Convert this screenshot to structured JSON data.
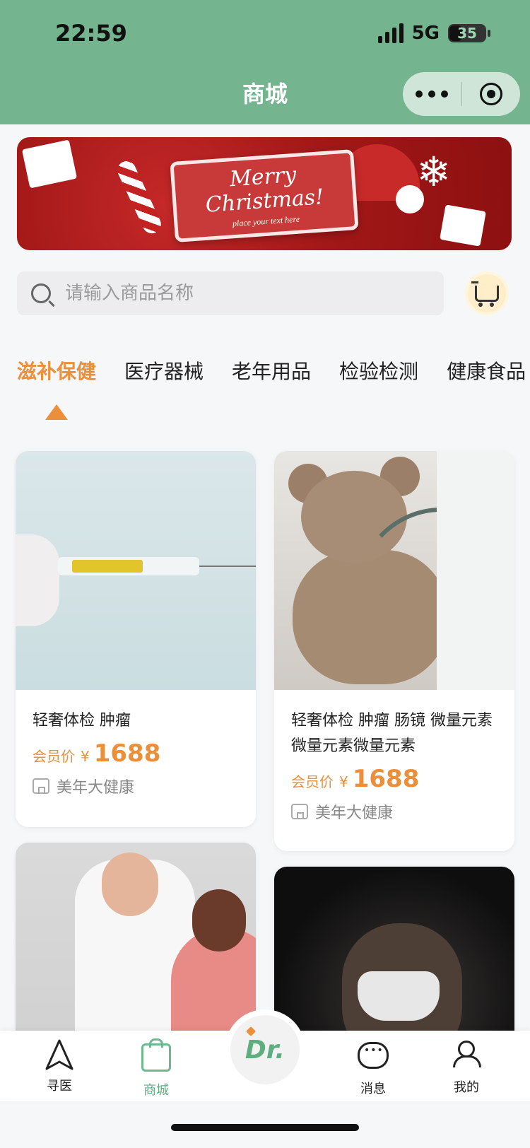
{
  "status_bar": {
    "time": "22:59",
    "network": "5G",
    "battery": "35"
  },
  "header": {
    "title": "商城"
  },
  "banner": {
    "title_line1": "Merry",
    "title_line2": "Christmas!",
    "subtitle": "place your text here"
  },
  "search": {
    "placeholder": "请输入商品名称"
  },
  "tabs": [
    {
      "label": "滋补保健"
    },
    {
      "label": "医疗器械"
    },
    {
      "label": "老年用品"
    },
    {
      "label": "检验检测"
    },
    {
      "label": "健康食品"
    }
  ],
  "products": [
    {
      "title": "轻奢体检 肿瘤",
      "price_label": "会员价",
      "currency": "¥",
      "price": "1688",
      "store": "美年大健康"
    },
    {
      "title": "轻奢体检 肿瘤 肠镜 微量元素微量元素微量元素",
      "price_label": "会员价",
      "currency": "¥",
      "price": "1688",
      "store": "美年大健康"
    },
    {
      "title": "",
      "price_label": "",
      "currency": "",
      "price": "",
      "store": ""
    },
    {
      "title": "",
      "price_label": "",
      "currency": "",
      "price": "",
      "store": ""
    }
  ],
  "bottom_nav": [
    {
      "label": "寻医",
      "icon": "navigation-icon"
    },
    {
      "label": "商城",
      "icon": "shopping-bag-icon"
    },
    {
      "label": "Dr.",
      "icon": "dr-logo-icon"
    },
    {
      "label": "消息",
      "icon": "message-icon"
    },
    {
      "label": "我的",
      "icon": "user-icon"
    }
  ],
  "colors": {
    "header": "#74b48f",
    "accent": "#ec8f3a",
    "nav_active": "#5fae80"
  }
}
